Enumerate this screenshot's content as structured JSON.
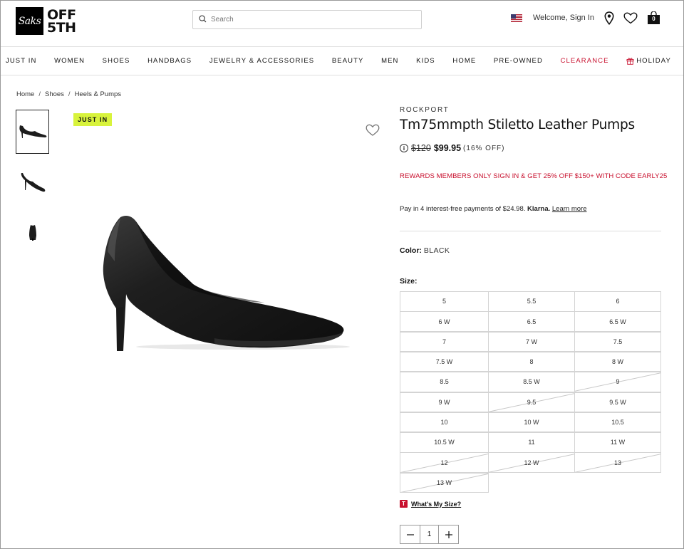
{
  "header": {
    "logo_mark": "Saks",
    "logo_line1": "OFF",
    "logo_line2": "5TH",
    "search_placeholder": "Search",
    "welcome": "Welcome, Sign In",
    "bag_count": "0"
  },
  "nav": [
    "JUST IN",
    "WOMEN",
    "SHOES",
    "HANDBAGS",
    "JEWELRY & ACCESSORIES",
    "BEAUTY",
    "MEN",
    "KIDS",
    "HOME",
    "PRE-OWNED",
    "CLEARANCE",
    "HOLIDAY"
  ],
  "breadcrumb": [
    "Home",
    "Shoes",
    "Heels & Pumps"
  ],
  "product": {
    "badge": "JUST IN",
    "brand": "ROCKPORT",
    "title": "Tm75mmpth Stiletto Leather Pumps",
    "original_price": "$120",
    "sale_price": "$99.95",
    "discount": "(16% OFF)",
    "promo": "REWARDS MEMBERS ONLY SIGN IN & GET 25% OFF $150+ WITH CODE EARLY25",
    "klarna": {
      "prefix": "Pay in 4 interest-free payments of $24.98.",
      "brand": "Klarna.",
      "link": "Learn more"
    },
    "color_label": "Color:",
    "color_value": "BLACK",
    "size_label": "Size:",
    "sizes": [
      {
        "label": "5",
        "available": true
      },
      {
        "label": "5.5",
        "available": true
      },
      {
        "label": "6",
        "available": true
      },
      {
        "label": "6 W",
        "available": true
      },
      {
        "label": "6.5",
        "available": true
      },
      {
        "label": "6.5 W",
        "available": true
      },
      {
        "label": "7",
        "available": true
      },
      {
        "label": "7 W",
        "available": true
      },
      {
        "label": "7.5",
        "available": true
      },
      {
        "label": "7.5 W",
        "available": true
      },
      {
        "label": "8",
        "available": true
      },
      {
        "label": "8 W",
        "available": true
      },
      {
        "label": "8.5",
        "available": true
      },
      {
        "label": "8.5 W",
        "available": true
      },
      {
        "label": "9",
        "available": false
      },
      {
        "label": "9 W",
        "available": true
      },
      {
        "label": "9.5",
        "available": false
      },
      {
        "label": "9.5 W",
        "available": true
      },
      {
        "label": "10",
        "available": true
      },
      {
        "label": "10 W",
        "available": true
      },
      {
        "label": "10.5",
        "available": true
      },
      {
        "label": "10.5 W",
        "available": true
      },
      {
        "label": "11",
        "available": true
      },
      {
        "label": "11 W",
        "available": true
      },
      {
        "label": "12",
        "available": false
      },
      {
        "label": "12 W",
        "available": false
      },
      {
        "label": "13",
        "available": false
      },
      {
        "label": "13 W",
        "available": false
      }
    ],
    "whats_my_size": "What's My Size?",
    "quantity": "1"
  },
  "colors": {
    "clearance": "#c8102e",
    "badge_bg": "#d8f33c",
    "promo": "#c8102e"
  }
}
